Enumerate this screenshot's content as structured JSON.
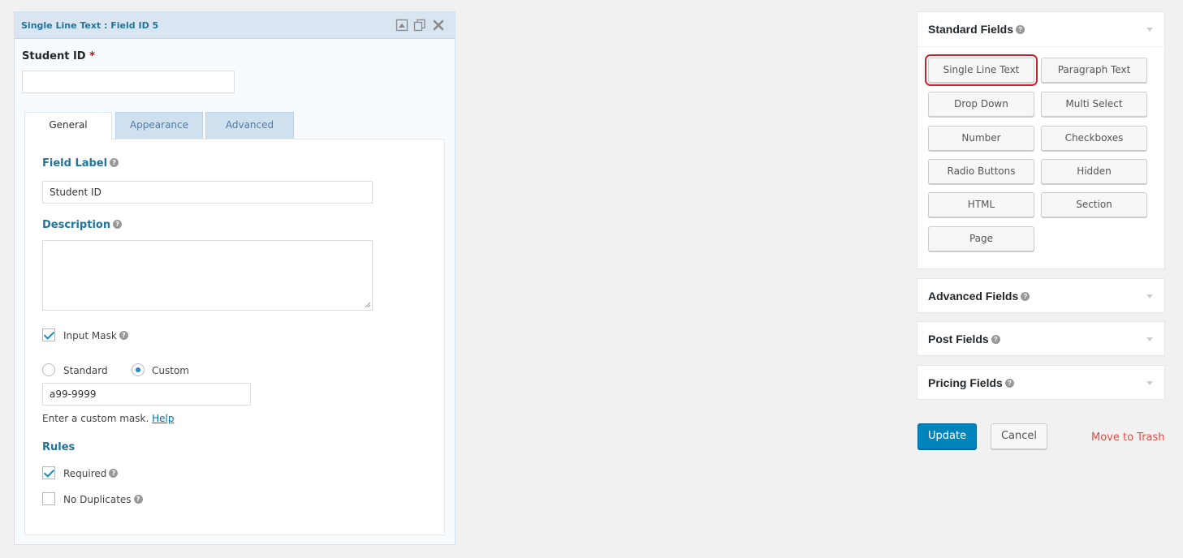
{
  "editor": {
    "title": "Single Line Text : Field ID 5",
    "preview_label": "Student ID",
    "required_marker": "*",
    "tabs": [
      "General",
      "Appearance",
      "Advanced"
    ],
    "field_label_heading": "Field Label",
    "field_label_value": "Student ID",
    "description_heading": "Description",
    "description_value": "",
    "input_mask_label": "Input Mask",
    "mask_standard": "Standard",
    "mask_custom": "Custom",
    "mask_value": "a99-9999",
    "mask_hint": "Enter a custom mask.",
    "mask_help_link": "Help",
    "rules_heading": "Rules",
    "required_label": "Required",
    "no_duplicates_label": "No Duplicates",
    "help_glyph": "?"
  },
  "sidebar": {
    "standard_title": "Standard Fields",
    "standard_buttons": [
      "Single Line Text",
      "Paragraph Text",
      "Drop Down",
      "Multi Select",
      "Number",
      "Checkboxes",
      "Radio Buttons",
      "Hidden",
      "HTML",
      "Section",
      "Page"
    ],
    "advanced_title": "Advanced Fields",
    "post_title": "Post Fields",
    "pricing_title": "Pricing Fields"
  },
  "actions": {
    "update": "Update",
    "cancel": "Cancel",
    "trash": "Move to Trash"
  },
  "icons": [
    "collapse-icon",
    "duplicate-icon",
    "delete-icon",
    "help-icon",
    "caret-down-icon"
  ],
  "colors": {
    "accent": "#21759b",
    "primary_button": "#0085ba",
    "trash": "#e14d43",
    "highlight": "#c0272d"
  }
}
